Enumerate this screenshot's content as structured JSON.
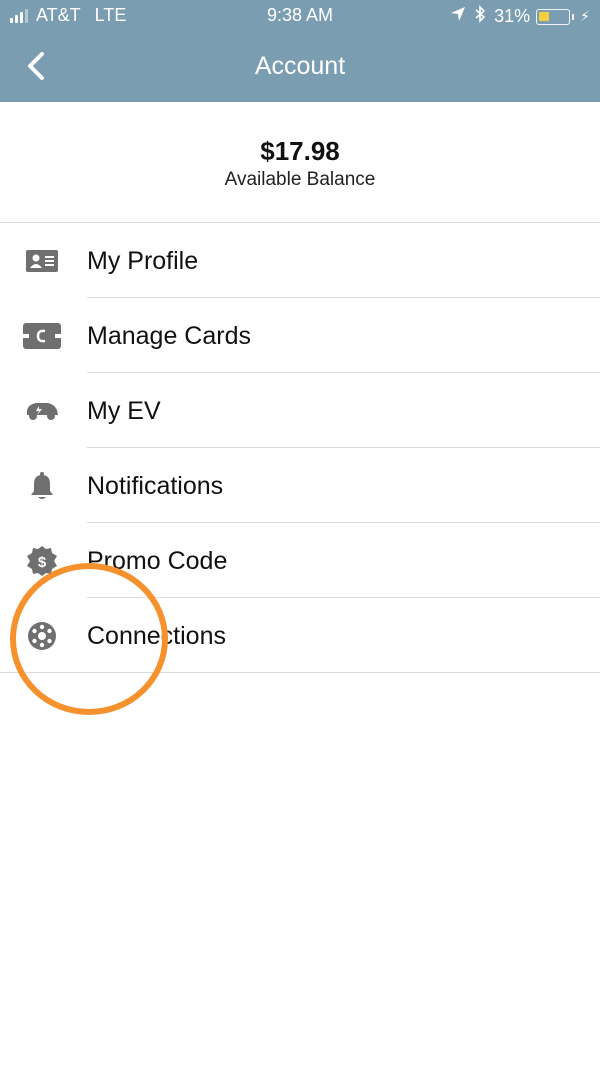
{
  "status_bar": {
    "carrier": "AT&T",
    "network": "LTE",
    "time": "9:38 AM",
    "battery": "31%",
    "battery_level": 0.31
  },
  "nav": {
    "title": "Account"
  },
  "balance": {
    "amount": "$17.98",
    "label": "Available Balance"
  },
  "menu": [
    {
      "label": "My Profile",
      "icon": "id-card-icon"
    },
    {
      "label": "Manage Cards",
      "icon": "card-icon"
    },
    {
      "label": "My EV",
      "icon": "car-icon"
    },
    {
      "label": "Notifications",
      "icon": "bell-icon"
    },
    {
      "label": "Promo Code",
      "icon": "dollar-badge-icon"
    },
    {
      "label": "Connections",
      "icon": "connections-icon"
    }
  ],
  "colors": {
    "header": "#7b9db1",
    "icon_gray": "#6f6f6f",
    "annotation": "#f5922d"
  }
}
